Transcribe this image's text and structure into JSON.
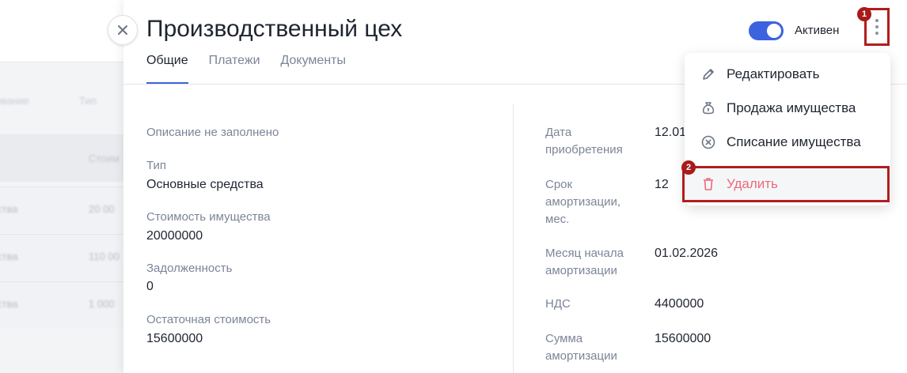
{
  "background": {
    "header_cells": [
      "ование",
      "Тип"
    ],
    "band_cell": "Стоим",
    "rows": [
      {
        "a": "ства",
        "b": "20 00"
      },
      {
        "a": "ства",
        "b": "110 00"
      },
      {
        "a": "ства",
        "b": "1 000"
      }
    ]
  },
  "drawer": {
    "title": "Производственный цех",
    "tabs": [
      "Общие",
      "Платежи",
      "Документы"
    ],
    "toggle_label": "Активен",
    "toggle_on": true,
    "accent_color": "#3b63e0",
    "danger_color": "#ec6a7a",
    "annotation_color": "#b01e1e"
  },
  "left_fields": {
    "description": "Описание не заполнено",
    "type_label": "Тип",
    "type_value": "Основные средства",
    "cost_label": "Стоимость имущества",
    "cost_value": "20000000",
    "debt_label": "Задолженность",
    "debt_value": "0",
    "residual_label": "Остаточная стоимость",
    "residual_value": "15600000"
  },
  "right_fields": {
    "purchase_label": "Дата приобретения",
    "purchase_value": "12.01",
    "term_label": "Срок амортизации, мес.",
    "term_value": "12",
    "start_label": "Месяц начала амортизации",
    "start_value": "01.02.2026",
    "vat_label": "НДС",
    "vat_value": "4400000",
    "amort_label": "Сумма амортизации",
    "amort_value": "15600000"
  },
  "menu": {
    "items": [
      {
        "label": "Редактировать",
        "icon": "pencil-icon"
      },
      {
        "label": "Продажа имущества",
        "icon": "money-bag-icon"
      },
      {
        "label": "Списание имущества",
        "icon": "circle-x-icon"
      },
      {
        "label": "Удалить",
        "icon": "trash-icon"
      }
    ]
  },
  "annotations": {
    "step1": "1",
    "step2": "2"
  }
}
